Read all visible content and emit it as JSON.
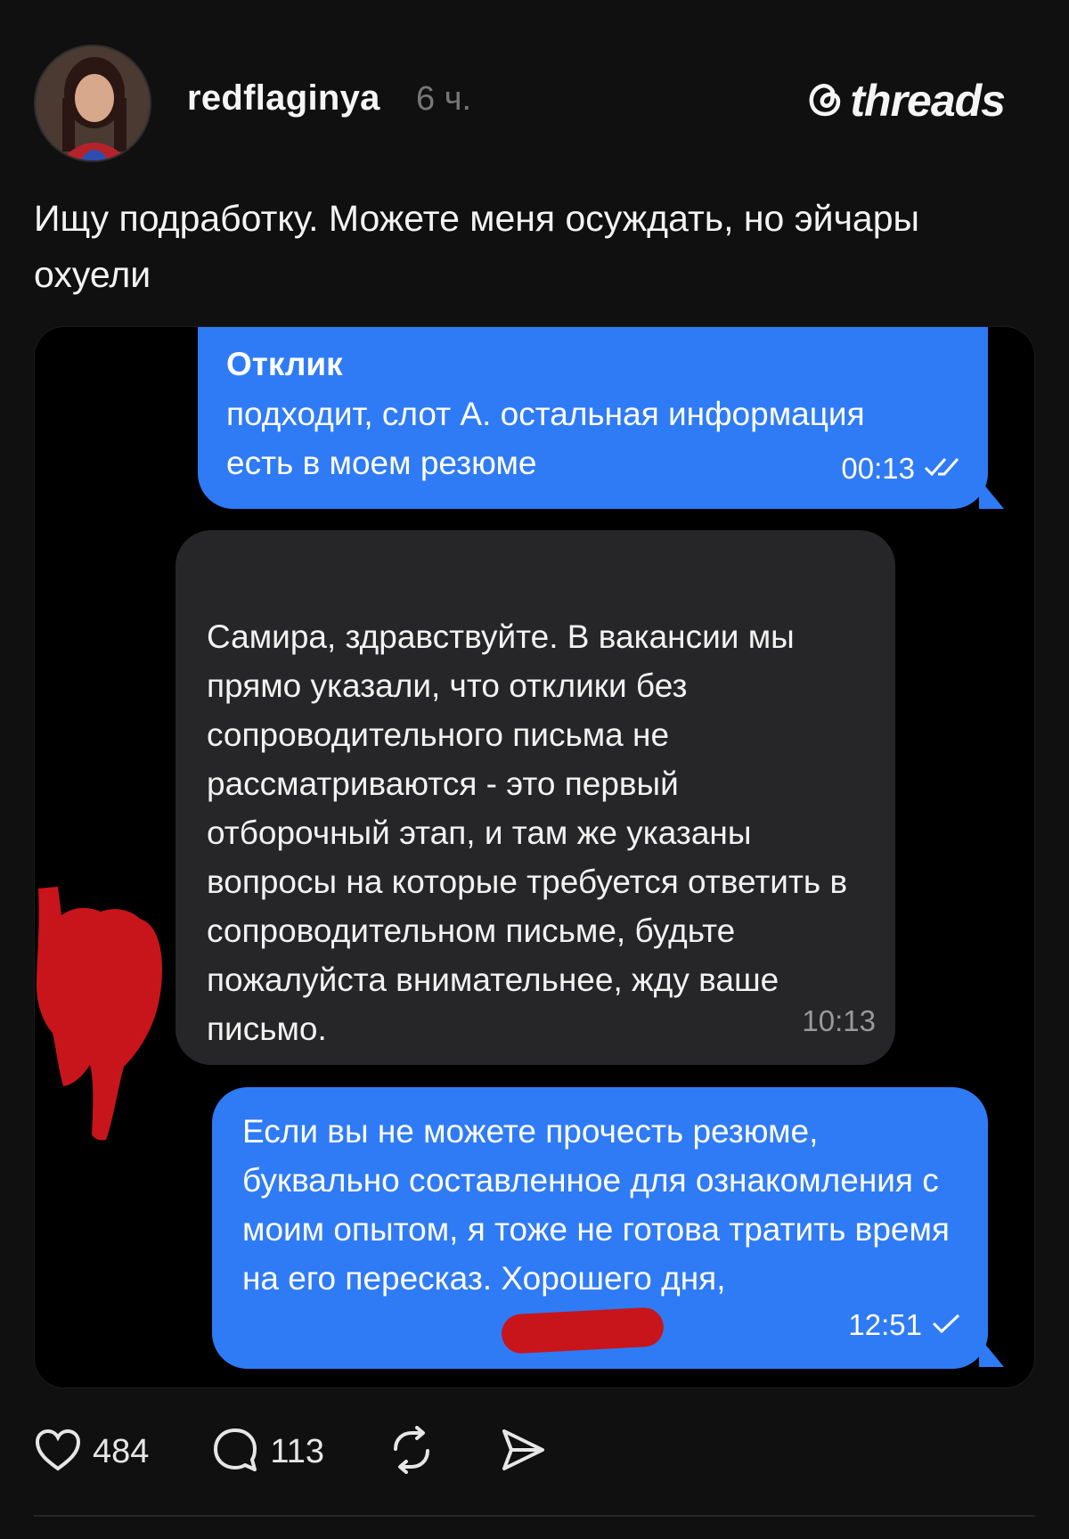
{
  "post": {
    "username": "redflaginya",
    "time_ago": "6 ч.",
    "brand": "threads",
    "text": "Ищу подработку. Можете меня осуждать, но эйчары охуели"
  },
  "chat": {
    "msg1": {
      "title": "Отклик",
      "text": "подходит, слот А. остальная информация есть в моем резюме",
      "time": "00:13"
    },
    "msg2": {
      "text": "Самира, здравствуйте. В вакансии мы прямо указали, что отклики без сопроводительного письма не рассматриваются - это первый отборочный этап, и там же указаны вопросы на которые требуется ответить в сопроводительном письме, будьте пожалуйста внимательнее, жду ваше письмо.",
      "time": "10:13"
    },
    "msg3": {
      "text": "Если вы не можете прочесть резюме, буквально составленное для ознакомления с моим опытом, я тоже не готова тратить время на его пересказ. Хорошего дня,",
      "time": "12:51"
    }
  },
  "actions": {
    "likes": "484",
    "comments": "113"
  },
  "colors": {
    "background": "#101010",
    "outgoing_bubble": "#2f7bf6",
    "incoming_bubble": "#262628",
    "redaction": "#c8151b"
  },
  "icons": [
    "avatar-photo",
    "threads-logo-icon",
    "double-check-icon",
    "check-icon",
    "heart-icon",
    "comment-icon",
    "repost-icon",
    "share-icon"
  ]
}
